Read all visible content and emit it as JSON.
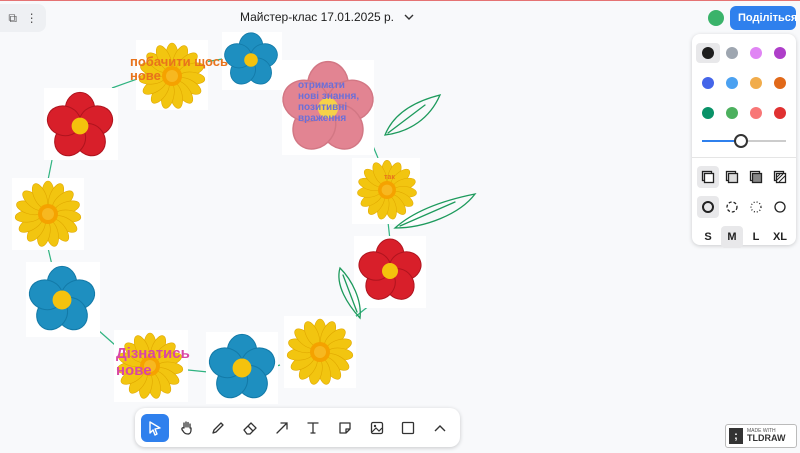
{
  "header": {
    "doc_title": "Майстер-клас 17.01.2025 р.",
    "share_label": "Поділіться"
  },
  "labels": {
    "flower_top": "побачити щось\nнове",
    "flower_pink": "отримати\nнові знання,\nпозитивні\nвраження",
    "flower_right": "так",
    "flower_bottom": "Дізнатись\nнове"
  },
  "style_panel": {
    "colors": [
      "#1d1d1d",
      "#9ea6b0",
      "#e085f4",
      "#ae3ec9",
      "#4465e9",
      "#4ba1f1",
      "#f1ac4b",
      "#e16919",
      "#099268",
      "#4cb05e",
      "#f87777",
      "#e03131"
    ],
    "selected_color_index": 0,
    "opacity_fraction": 0.5,
    "sizes": [
      "S",
      "M",
      "L",
      "XL"
    ],
    "selected_size": "M"
  },
  "badge": {
    "line1": "MADE WITH",
    "line2": "TLDRAW"
  },
  "colors": {
    "accent": "#2f80ed",
    "avatar": "#3ab36a",
    "drawing_stroke": "#1d9a5c"
  }
}
